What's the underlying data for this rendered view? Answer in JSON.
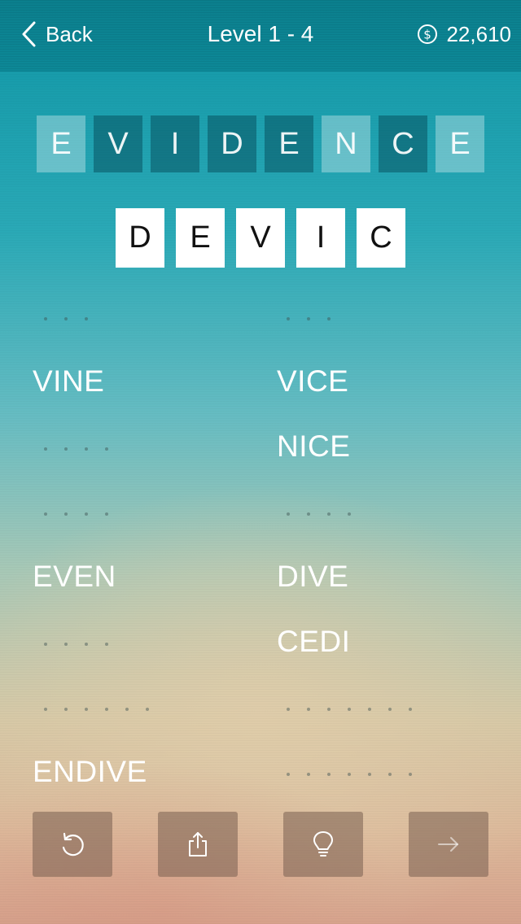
{
  "header": {
    "back_label": "Back",
    "title": "Level 1 - 4",
    "coins": "22,610"
  },
  "source_letters": [
    {
      "letter": "E",
      "used": false
    },
    {
      "letter": "V",
      "used": true
    },
    {
      "letter": "I",
      "used": true
    },
    {
      "letter": "D",
      "used": true
    },
    {
      "letter": "E",
      "used": true
    },
    {
      "letter": "N",
      "used": false
    },
    {
      "letter": "C",
      "used": true
    },
    {
      "letter": "E",
      "used": false
    }
  ],
  "current_word": [
    "D",
    "E",
    "V",
    "I",
    "C"
  ],
  "word_grid": [
    [
      {
        "word": "",
        "length": 3
      },
      {
        "word": "",
        "length": 3
      }
    ],
    [
      {
        "word": "VINE",
        "length": 4
      },
      {
        "word": "VICE",
        "length": 4
      }
    ],
    [
      {
        "word": "",
        "length": 4
      },
      {
        "word": "NICE",
        "length": 4
      }
    ],
    [
      {
        "word": "",
        "length": 4
      },
      {
        "word": "",
        "length": 4
      }
    ],
    [
      {
        "word": "EVEN",
        "length": 4
      },
      {
        "word": "DIVE",
        "length": 4
      }
    ],
    [
      {
        "word": "",
        "length": 4
      },
      {
        "word": "CEDI",
        "length": 4
      }
    ],
    [
      {
        "word": "",
        "length": 6
      },
      {
        "word": "",
        "length": 7
      }
    ],
    [
      {
        "word": "ENDIVE",
        "length": 6
      },
      {
        "word": "",
        "length": 7
      }
    ]
  ],
  "buttons": [
    {
      "name": "reset-button",
      "icon": "undo-icon"
    },
    {
      "name": "share-button",
      "icon": "share-icon"
    },
    {
      "name": "hint-button",
      "icon": "lightbulb-icon"
    },
    {
      "name": "next-button",
      "icon": "arrow-right-icon"
    }
  ],
  "colors": {
    "topbar": "#0b7f8d",
    "tile_white": "#ffffff",
    "button_bg": "#7a5f50"
  }
}
